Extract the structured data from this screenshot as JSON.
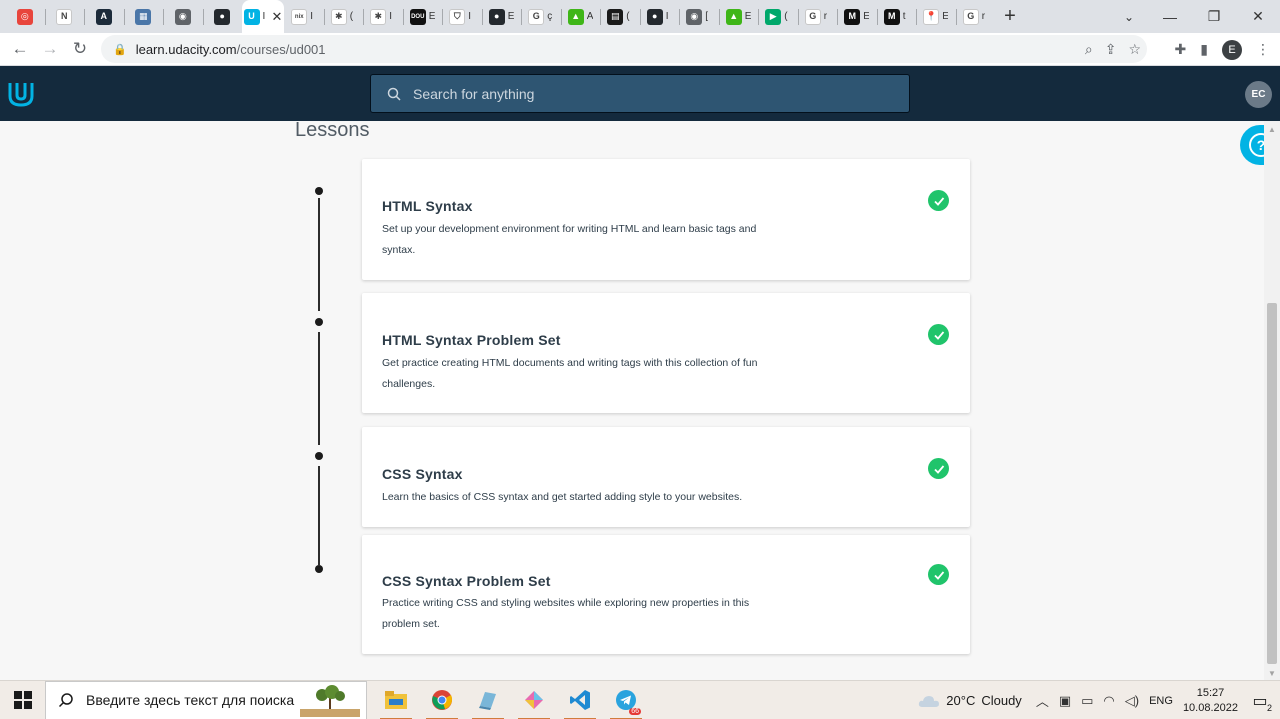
{
  "browser": {
    "tabs": [
      {
        "icon": "openai-icon",
        "color": "#e8453c",
        "glyph": "◎",
        "char": ""
      },
      {
        "icon": "notion-icon",
        "color": "#ffffff",
        "glyph": "N",
        "char": ""
      },
      {
        "icon": "app-a-icon",
        "color": "#1c2b3a",
        "glyph": "A",
        "char": ""
      },
      {
        "icon": "site-icon",
        "color": "#4a76a8",
        "glyph": "▦",
        "char": ""
      },
      {
        "icon": "globe-icon",
        "color": "#5f6368",
        "glyph": "◉",
        "char": ""
      },
      {
        "icon": "github-icon",
        "color": "#24292e",
        "glyph": "●",
        "char": ""
      },
      {
        "icon": "udacity-tab-icon",
        "color": "#02b3e4",
        "glyph": "U",
        "char": "I"
      },
      {
        "icon": "nix-icon",
        "color": "#ffffff",
        "glyph": "nix",
        "char": "I"
      },
      {
        "icon": "figure-icon",
        "color": "#ffffff",
        "glyph": "✱",
        "char": "("
      },
      {
        "icon": "figure-icon",
        "color": "#ffffff",
        "glyph": "✱",
        "char": "I"
      },
      {
        "icon": "dou-icon",
        "color": "#111111",
        "glyph": "DOU",
        "char": "E"
      },
      {
        "icon": "shield-icon",
        "color": "#ffffff",
        "glyph": "⛉",
        "char": "I"
      },
      {
        "icon": "github-icon",
        "color": "#24292e",
        "glyph": "●",
        "char": "E"
      },
      {
        "icon": "google-icon",
        "color": "#ffffff",
        "glyph": "G",
        "char": "ç"
      },
      {
        "icon": "green-app-icon",
        "color": "#3fb618",
        "glyph": "▲",
        "char": "A"
      },
      {
        "icon": "terminal-icon",
        "color": "#1a1a1a",
        "glyph": "▤",
        "char": "("
      },
      {
        "icon": "github-icon",
        "color": "#24292e",
        "glyph": "●",
        "char": "I"
      },
      {
        "icon": "globe-icon",
        "color": "#5f6368",
        "glyph": "◉",
        "char": "["
      },
      {
        "icon": "green-app-icon",
        "color": "#3fb618",
        "glyph": "▲",
        "char": "E"
      },
      {
        "icon": "play-icon",
        "color": "#00a86b",
        "glyph": "▶",
        "char": "("
      },
      {
        "icon": "google-icon",
        "color": "#ffffff",
        "glyph": "G",
        "char": "r"
      },
      {
        "icon": "medium-icon",
        "color": "#111111",
        "glyph": "M",
        "char": "E"
      },
      {
        "icon": "medium-icon",
        "color": "#111111",
        "glyph": "M",
        "char": "t"
      },
      {
        "icon": "maps-icon",
        "color": "#ffffff",
        "glyph": "📍",
        "char": "E"
      },
      {
        "icon": "google-icon",
        "color": "#ffffff",
        "glyph": "G",
        "char": "r"
      }
    ],
    "url_host": "learn.udacity.com",
    "url_path": "/courses/ud001",
    "profile_letter": "E"
  },
  "header": {
    "search_placeholder": "Search for anything",
    "avatar_initials": "EC"
  },
  "page": {
    "section_title": "Lessons",
    "lessons": [
      {
        "title": "HTML Syntax",
        "description": "Set up your development environment for writing HTML and learn basic tags and syntax.",
        "completed": true
      },
      {
        "title": "HTML Syntax Problem Set",
        "description": "Get practice creating HTML documents and writing tags with this collection of fun challenges.",
        "completed": true
      },
      {
        "title": "CSS Syntax",
        "description": "Learn the basics of CSS syntax and get started adding style to your websites.",
        "completed": true
      },
      {
        "title": "CSS Syntax Problem Set",
        "description": "Practice writing CSS and styling websites while exploring new properties in this problem set.",
        "completed": true
      }
    ]
  },
  "taskbar": {
    "search_placeholder": "Введите здесь текст для поиска",
    "weather_temp": "20°C",
    "weather_text": "Cloudy",
    "language": "ENG",
    "time": "15:27",
    "date": "10.08.2022",
    "notification_count": "2",
    "telegram_badge": "66"
  },
  "colors": {
    "udacity_navy": "#142a3d",
    "check_green": "#02b3e4",
    "search_bg": "#2e5572"
  }
}
